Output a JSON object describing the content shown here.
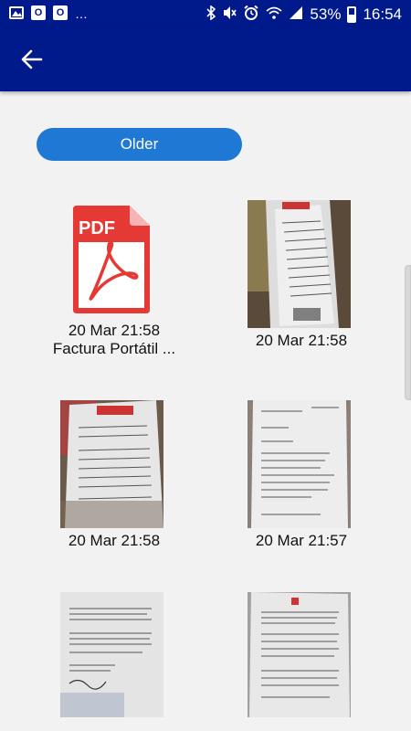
{
  "status_bar": {
    "icons_left": [
      "gallery-icon",
      "outlook-icon",
      "outlook-icon",
      "more-notifications-icon"
    ],
    "icons_right": [
      "bluetooth-icon",
      "mute-icon",
      "alarm-icon",
      "wifi-icon",
      "signal-icon"
    ],
    "battery": "53%",
    "time": "16:54"
  },
  "toolbar": {
    "back_icon": "arrow-back-icon"
  },
  "older_button": {
    "label": "Older"
  },
  "items": [
    {
      "type": "pdf",
      "icon_text": "PDF",
      "date": "20 Mar 21:58",
      "name": "Factura Portátil ..."
    },
    {
      "type": "image",
      "date": "20 Mar 21:58"
    },
    {
      "type": "image",
      "date": "20 Mar 21:58"
    },
    {
      "type": "image",
      "date": "20 Mar 21:57"
    },
    {
      "type": "image",
      "date": ""
    },
    {
      "type": "image",
      "date": ""
    }
  ],
  "colors": {
    "primary": "#001a8c",
    "accent": "#1e78d4",
    "pdf_red": "#e53935"
  }
}
